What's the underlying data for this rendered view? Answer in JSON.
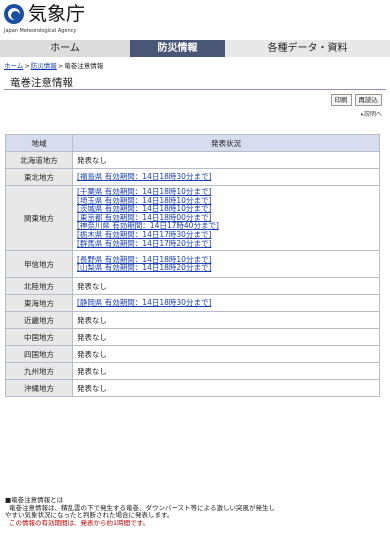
{
  "header": {
    "logo_text": "気象庁",
    "logo_sub": "Japan Meteorological Agency"
  },
  "nav": {
    "home": "ホーム",
    "disaster": "防災情報",
    "data": "各種データ・資料"
  },
  "breadcrumb": {
    "home": "ホーム",
    "disaster": "防災情報",
    "current": "竜巻注意情報"
  },
  "page_title": "竜巻注意情報",
  "tools": {
    "print": "印刷",
    "reload": "再読込",
    "explain": "説明へ"
  },
  "table": {
    "headers": [
      "地域",
      "発表状況"
    ],
    "rows": [
      {
        "region": "北海道地方",
        "status": "発表なし",
        "links": []
      },
      {
        "region": "東北地方",
        "links": [
          "[福島県 有効期間：14日18時30分まで]"
        ]
      },
      {
        "region": "関東地方",
        "links": [
          "[千葉県 有効期間：14日18時10分まで]",
          "[埼玉県 有効期間：14日18時10分まで]",
          "[茨城県 有効期間：14日18時10分まで]",
          "[東京都 有効期間：14日18時00分まで]",
          "[神奈川県 有効期間：14日17時40分まで]",
          "[栃木県 有効期間：14日17時30分まで]",
          "[群馬県 有効期間：14日17時20分まで]"
        ]
      },
      {
        "region": "甲信地方",
        "links": [
          "[長野県 有効期間：14日18時10分まで]",
          "[山梨県 有効期間：14日18時20分まで]"
        ]
      },
      {
        "region": "北陸地方",
        "status": "発表なし",
        "links": []
      },
      {
        "region": "東海地方",
        "links": [
          "[静岡県 有効期間：14日18時30分まで]"
        ]
      },
      {
        "region": "近畿地方",
        "status": "発表なし",
        "links": []
      },
      {
        "region": "中国地方",
        "status": "発表なし",
        "links": []
      },
      {
        "region": "四国地方",
        "status": "発表なし",
        "links": []
      },
      {
        "region": "九州地方",
        "status": "発表なし",
        "links": []
      },
      {
        "region": "沖縄地方",
        "status": "発表なし",
        "links": []
      }
    ]
  },
  "notes": {
    "heading": "■竜巻注意情報とは",
    "body1": "竜巻注意情報は、積乱雲の下で発生する竜巻、ダウンバースト等による激しい突風が発生し",
    "body2": "やすい気象状況になったと判断された場合に発表します。",
    "red": "この情報の有効期間は、発表から約1時間です。"
  },
  "colors": {
    "nav_active": "#4a5675",
    "link": "#1a3fb0",
    "header_bg": "#d7dcee",
    "region_bg": "#e8e8e8",
    "warning": "#c00000"
  }
}
